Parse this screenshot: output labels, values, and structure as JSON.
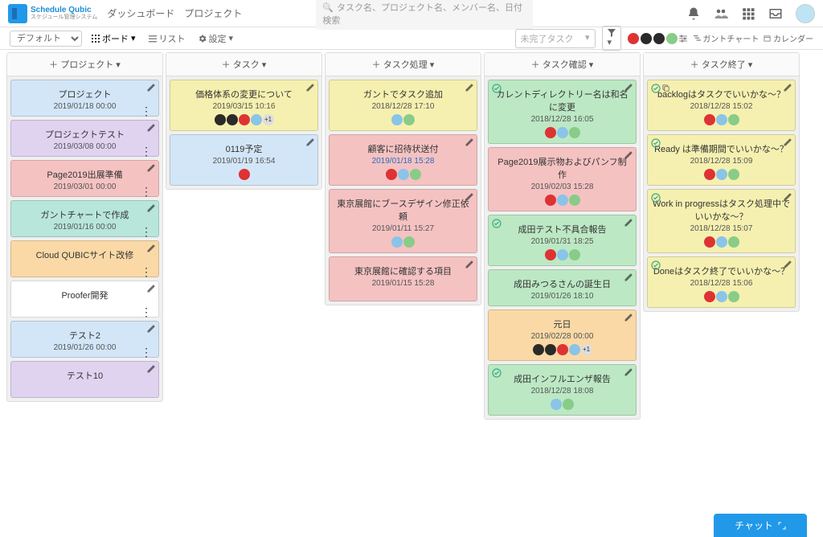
{
  "app": {
    "name": "Schedule Qubic",
    "tagline": "スケジュール管理システム"
  },
  "nav": {
    "dashboard": "ダッシュボード",
    "projects": "プロジェクト"
  },
  "search": {
    "placeholder": "タスク名、プロジェクト名、メンバー名、日付検索"
  },
  "toolbar": {
    "default": "デフォルト",
    "board": "ボード",
    "list": "リスト",
    "settings": "設定",
    "incomplete": "未完了タスク",
    "gantt": "ガントチャート",
    "calendar": "カレンダー"
  },
  "columns": [
    {
      "header": "＋ プロジェクト",
      "cards": [
        {
          "title": "プロジェクト",
          "date": "2019/01/18 00:00",
          "color": "c-blue",
          "menu": true
        },
        {
          "title": "プロジェクトテスト",
          "date": "2019/03/08 00:00",
          "color": "c-purple",
          "menu": true
        },
        {
          "title": "Page2019出展準備",
          "date": "2019/03/01 00:00",
          "color": "c-red",
          "menu": true
        },
        {
          "title": "ガントチャートで作成",
          "date": "2019/01/16 00:00",
          "color": "c-teal",
          "menu": true
        },
        {
          "title": "Cloud QUBICサイト改修",
          "date": "",
          "color": "c-orange",
          "menu": true
        },
        {
          "title": "Proofer開発",
          "date": "",
          "color": "c-white",
          "menu": true
        },
        {
          "title": "テスト2",
          "date": "2019/01/26 00:00",
          "color": "c-blue",
          "menu": true
        },
        {
          "title": "テスト10",
          "date": "",
          "color": "c-purple",
          "menu": false
        }
      ]
    },
    {
      "header": "＋ タスク",
      "cards": [
        {
          "title": "価格体系の変更について",
          "date": "2019/03/15 10:16",
          "color": "c-yellow",
          "avatars": [
            "dark",
            "dark",
            "red",
            "blue",
            "count"
          ],
          "ext": true
        },
        {
          "title": "0119予定",
          "date": "2019/01/19 16:54",
          "color": "c-blue",
          "avatars": [
            "red"
          ],
          "ext": true
        }
      ]
    },
    {
      "header": "＋ タスク処理",
      "cards": [
        {
          "title": "ガントでタスク追加",
          "date": "2018/12/28 17:10",
          "color": "c-yellow",
          "avatars": [
            "blue",
            "green"
          ],
          "ext": true
        },
        {
          "title": "顧客に招待状送付",
          "date": "2019/01/18 15:28",
          "color": "c-pink",
          "link": true,
          "avatars": [
            "red",
            "blue",
            "green"
          ],
          "ext": true
        },
        {
          "title": "東京展館にブースデザイン修正依頼",
          "date": "2019/01/11 15:27",
          "color": "c-pink",
          "avatars": [
            "blue",
            "green"
          ],
          "ext": true
        },
        {
          "title": "東京展館に確認する項目",
          "date": "2019/01/15 15:28",
          "color": "c-pink",
          "ext": true
        }
      ]
    },
    {
      "header": "＋ タスク確認",
      "cards": [
        {
          "title": "カレントディレクトリー名は和名に変更",
          "date": "2018/12/28 16:05",
          "color": "c-green",
          "check": true,
          "avatars": [
            "red",
            "blue",
            "green"
          ],
          "ext": true
        },
        {
          "title": "Page2019展示物およびパンフ制作",
          "date": "2019/02/03 15:28",
          "color": "c-pink",
          "avatars": [
            "red",
            "blue",
            "green"
          ],
          "ext": true
        },
        {
          "title": "成田テスト不具合報告",
          "date": "2019/01/31 18:25",
          "color": "c-green",
          "check": true,
          "avatars": [
            "red",
            "blue",
            "green"
          ],
          "ext": true
        },
        {
          "title": "成田みつるさんの誕生日",
          "date": "2019/01/26 18:10",
          "color": "c-green"
        },
        {
          "title": "元日",
          "date": "2019/02/28 00:00",
          "color": "c-orange",
          "avatars": [
            "dark",
            "dark",
            "red",
            "blue",
            "count"
          ],
          "ext": true
        },
        {
          "title": "成田インフルエンザ報告",
          "date": "2018/12/28 18:08",
          "color": "c-green",
          "check": true,
          "avatars": [
            "blue",
            "green"
          ],
          "ext": true
        }
      ]
    },
    {
      "header": "＋ タスク終了",
      "cards": [
        {
          "title": "backlogはタスクでいいかな～？",
          "date": "2018/12/28 15:02",
          "color": "c-yellow",
          "check": true,
          "copy": true,
          "avatars": [
            "red",
            "blue",
            "green"
          ],
          "ext": true
        },
        {
          "title": "Ready は準備期間でいいかな～？",
          "date": "2018/12/28 15:09",
          "color": "c-yellow",
          "check": true,
          "avatars": [
            "red",
            "blue",
            "green"
          ],
          "ext": true
        },
        {
          "title": "Work in progressはタスク処理中でいいかな～？",
          "date": "2018/12/28 15:07",
          "color": "c-yellow",
          "check": true,
          "avatars": [
            "red",
            "blue",
            "green"
          ],
          "ext": true
        },
        {
          "title": "Doneはタスク終了でいいかな～？",
          "date": "2018/12/28 15:06",
          "color": "c-yellow",
          "check": true,
          "avatars": [
            "red",
            "blue",
            "green"
          ],
          "ext": true
        }
      ]
    }
  ],
  "chat": "チャット"
}
